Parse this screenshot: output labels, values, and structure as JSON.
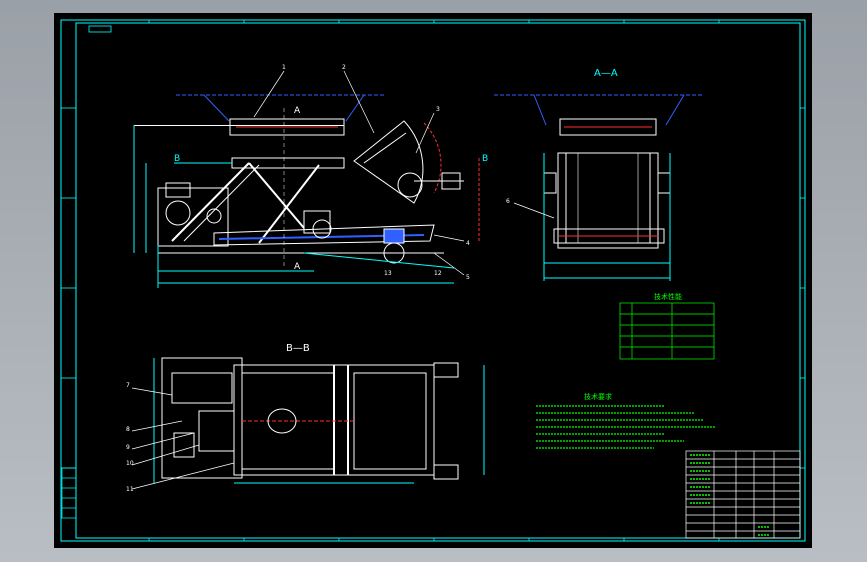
{
  "drawing": {
    "title_stamp": "",
    "view_labels": {
      "section_aa": "A—A",
      "section_bb": "B—B",
      "marker_a_top": "A",
      "marker_a_bottom": "A",
      "marker_b_left": "B",
      "marker_b_right": "B"
    },
    "part_callouts": [
      "1",
      "2",
      "3",
      "4",
      "5",
      "6",
      "7",
      "8",
      "9",
      "10",
      "11",
      "12",
      "13"
    ],
    "table_heading": "技术性能",
    "notes_heading": "技术要求",
    "title_block_name": "",
    "title_block_drawing_no": ""
  },
  "colors": {
    "background": "#000000",
    "frame_line": "#00ffff",
    "geometry": "#ffffff",
    "table_line": "#00ff00",
    "notes_text": "#00ff00",
    "dimension": "#00ffff",
    "accent_red": "#ff3030",
    "accent_blue": "#3060ff",
    "accent_yellow": "#ffff00"
  },
  "icons": {
    "frame": "drawing-border",
    "title_block": "title-block-grid"
  }
}
